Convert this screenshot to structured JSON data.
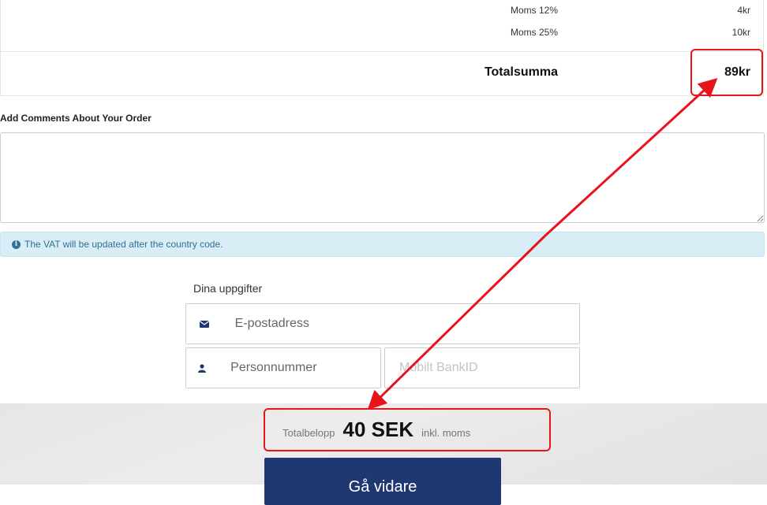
{
  "totals": {
    "vat_rows": [
      {
        "label": "Moms 12%",
        "value": "4kr"
      },
      {
        "label": "Moms 25%",
        "value": "10kr"
      }
    ],
    "total_label": "Totalsumma",
    "total_value": "89kr"
  },
  "comments": {
    "label": "Add Comments About Your Order",
    "value": ""
  },
  "info": {
    "icon": "info-circle-icon",
    "text": "The VAT will be updated after the country code."
  },
  "customer": {
    "title": "Dina uppgifter",
    "email_placeholder": "E-postadress",
    "email_icon": "envelope-icon",
    "personnummer_placeholder": "Personnummer",
    "person_icon": "user-icon",
    "bankid_placeholder": "Mobilt BankID"
  },
  "summary": {
    "label": "Totalbelopp",
    "amount": "40 SEK",
    "note": "inkl. moms"
  },
  "go_button": "Gå vidare",
  "colors": {
    "primary_button": "#1f3872",
    "annotation": "#e8141b",
    "info_bg": "#d9edf7",
    "info_text": "#31708f"
  }
}
